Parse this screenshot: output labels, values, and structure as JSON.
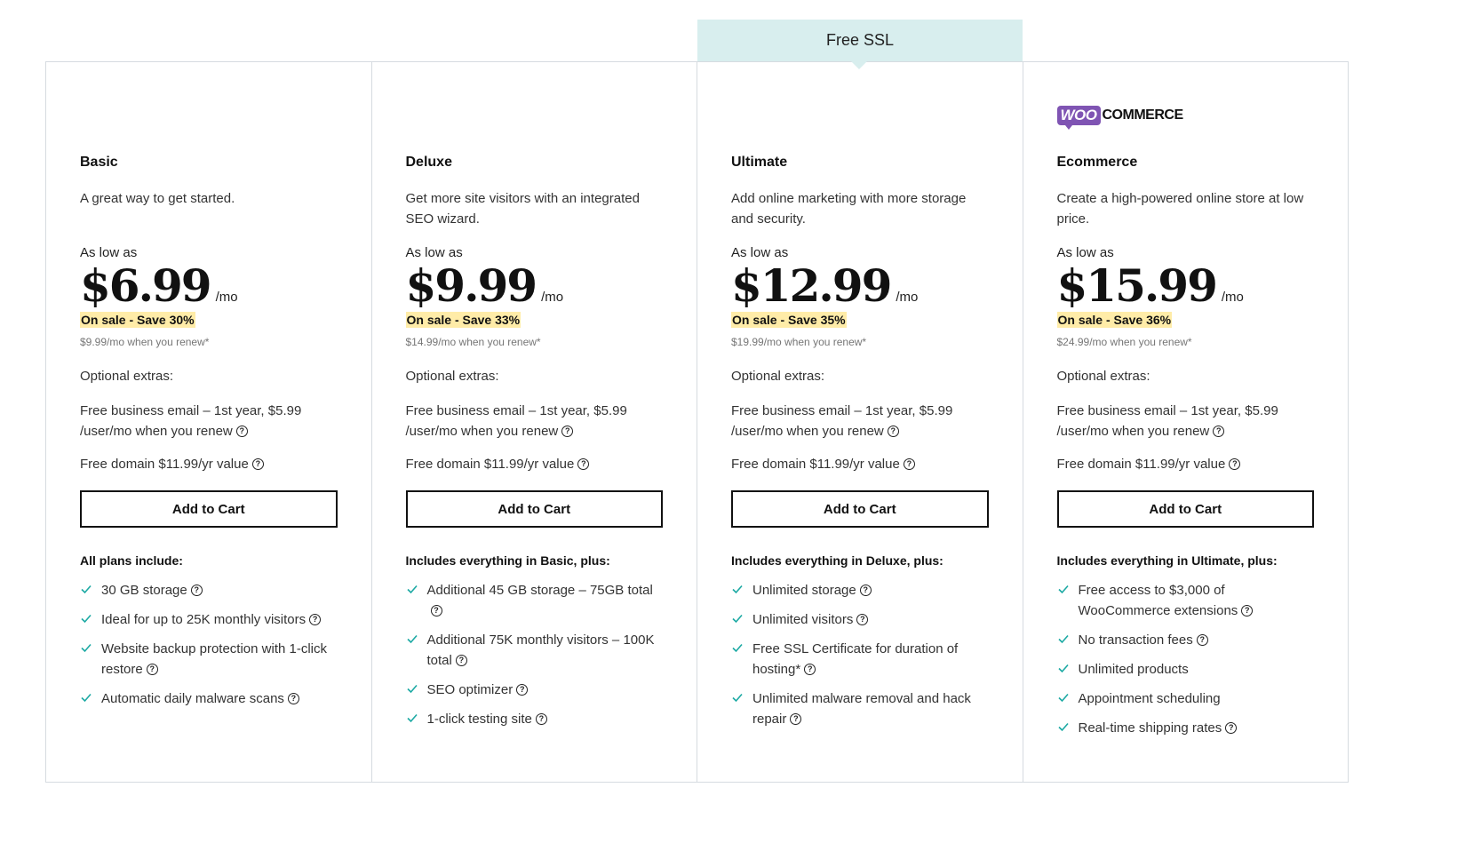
{
  "banner": {
    "label": "Free SSL"
  },
  "common": {
    "as_low_as": "As low as",
    "per_month": "/mo",
    "optional_extras": "Optional extras:",
    "email_line1": "Free business email – 1st year, $5.99",
    "email_line2": "/user/mo when you renew",
    "domain": "Free domain $11.99/yr value",
    "add_to_cart": "Add to Cart",
    "help_glyph": "?"
  },
  "colors": {
    "check": "#1ba9a3",
    "sale_bg": "#ffeca8",
    "badge_bg": "#d8eeee",
    "woo_purple": "#7f54b3"
  },
  "plans": [
    {
      "name": "Basic",
      "description": "A great way to get started.",
      "price": "$6.99",
      "sale": "On sale - Save 30%",
      "renew": "$9.99/mo when you renew*",
      "features_heading": "All plans include:",
      "features": [
        {
          "text": "30 GB storage",
          "help": true
        },
        {
          "text": "Ideal for up to 25K monthly visitors",
          "help": true
        },
        {
          "text": "Website backup protection with 1-click restore",
          "help": true
        },
        {
          "text": "Automatic daily malware scans",
          "help": true
        }
      ]
    },
    {
      "name": "Deluxe",
      "description": "Get more site visitors with an integrated SEO wizard.",
      "price": "$9.99",
      "sale": "On sale - Save 33%",
      "renew": "$14.99/mo when you renew*",
      "features_heading": "Includes everything in Basic, plus:",
      "features": [
        {
          "text": "Additional 45 GB storage – 75GB total",
          "help": true
        },
        {
          "text": "Additional 75K monthly visitors – 100K total",
          "help": true
        },
        {
          "text": "SEO optimizer",
          "help": true
        },
        {
          "text": "1-click testing site",
          "help": true
        }
      ]
    },
    {
      "name": "Ultimate",
      "description": "Add online marketing with more storage and security.",
      "price": "$12.99",
      "sale": "On sale - Save 35%",
      "renew": "$19.99/mo when you renew*",
      "features_heading": "Includes everything in Deluxe, plus:",
      "features": [
        {
          "text": "Unlimited storage",
          "help": true
        },
        {
          "text": "Unlimited visitors",
          "help": true
        },
        {
          "text": "Free SSL Certificate for duration of hosting*",
          "help": true
        },
        {
          "text": "Unlimited malware removal and hack repair",
          "help": true
        }
      ]
    },
    {
      "name": "Ecommerce",
      "logo": {
        "woo": "WOO",
        "commerce": "COMMERCE"
      },
      "description": "Create a high-powered online store at low price.",
      "price": "$15.99",
      "sale": "On sale - Save 36%",
      "renew": "$24.99/mo when you renew*",
      "features_heading": "Includes everything in Ultimate, plus:",
      "features": [
        {
          "text": "Free access to $3,000 of WooCommerce extensions",
          "help": true
        },
        {
          "text": "No transaction fees",
          "help": true
        },
        {
          "text": "Unlimited products",
          "help": false
        },
        {
          "text": "Appointment scheduling",
          "help": false
        },
        {
          "text": "Real-time shipping rates",
          "help": true
        }
      ]
    }
  ]
}
